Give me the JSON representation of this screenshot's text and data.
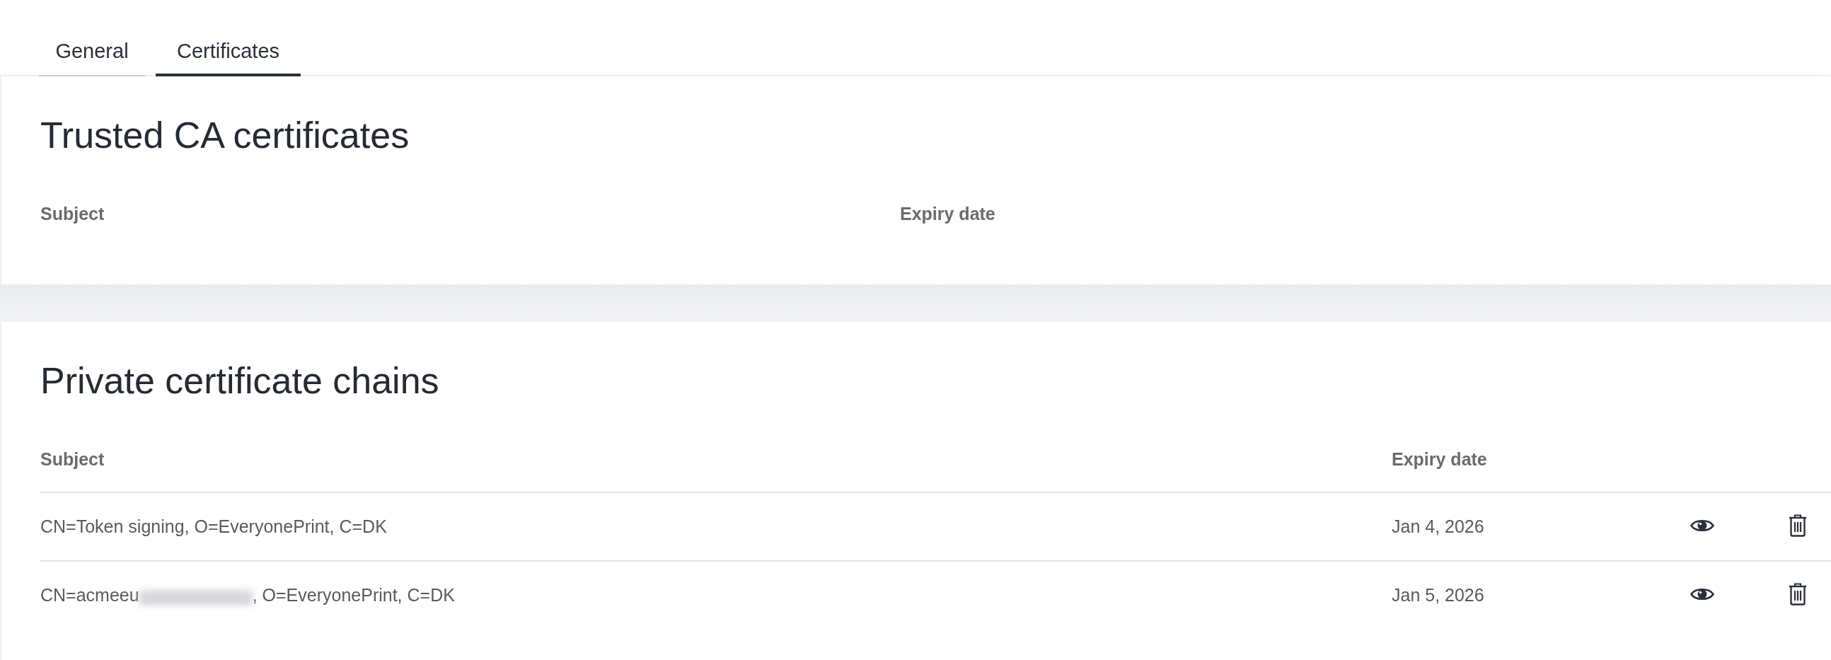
{
  "tabs": [
    {
      "label": "General",
      "selected": false
    },
    {
      "label": "Certificates",
      "selected": true
    }
  ],
  "sections": [
    {
      "title": "Trusted CA certificates",
      "columns": [
        "Subject",
        "Expiry date"
      ]
    },
    {
      "title": "Private certificate chains",
      "columns": [
        "Subject",
        "Expiry date"
      ],
      "rows": [
        {
          "subject_start": "CN=Token signing, O=EveryonePrint, C=DK",
          "redacted": false,
          "expiry": "Jan 4, 2026"
        },
        {
          "subject_start": "CN=acmeeu",
          "redacted": true,
          "subject_end": ", O=EveryonePrint, C=DK",
          "expiry": "Jan 5, 2026"
        }
      ]
    }
  ]
}
